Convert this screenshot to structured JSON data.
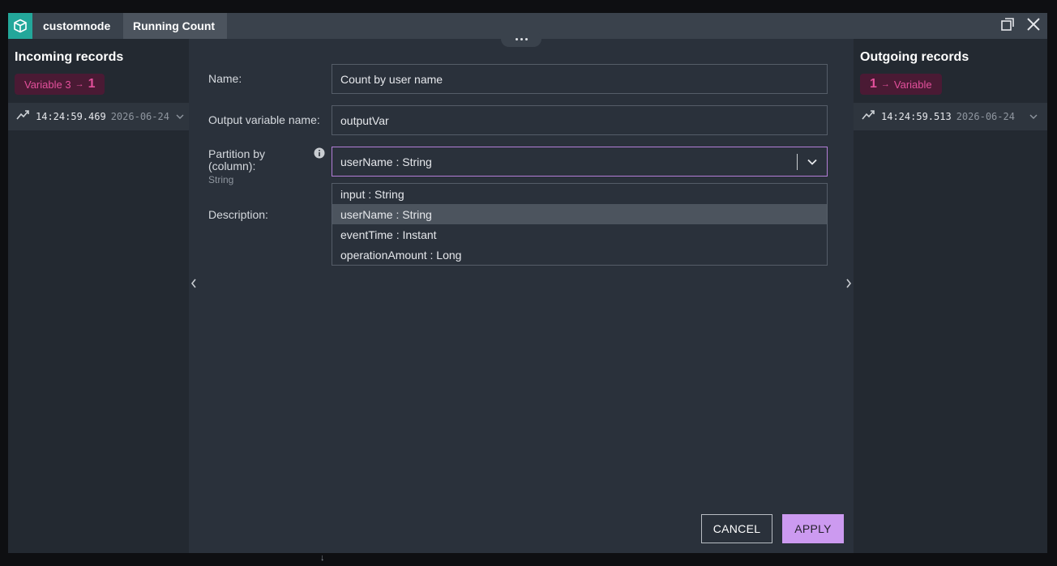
{
  "header": {
    "node_type": "customnode",
    "node_name": "Running Count",
    "icons": {
      "app": "cube-icon",
      "expand": "expand-icon",
      "close": "close-icon"
    }
  },
  "incoming": {
    "title": "Incoming records",
    "badge_text": "Variable 3",
    "badge_arrow": "→",
    "badge_count": "1",
    "record_time": "14:24:59.469",
    "record_date": "2026-06-24"
  },
  "outgoing": {
    "title": "Outgoing records",
    "badge_count": "1",
    "badge_arrow": "→",
    "badge_text": "Variable",
    "record_time": "14:24:59.513",
    "record_date": "2026-06-24"
  },
  "form": {
    "name_label": "Name:",
    "name_value": "Count by user name",
    "output_label": "Output variable name:",
    "output_value": "outputVar",
    "partition_label_1": "Partition by",
    "partition_label_2": "(column):",
    "partition_type": "String",
    "partition_selected": "userName : String",
    "partition_options": [
      {
        "label": "input : String"
      },
      {
        "label": "userName : String"
      },
      {
        "label": "eventTime : Instant"
      },
      {
        "label": "operationAmount : Long"
      }
    ],
    "description_label": "Description:"
  },
  "buttons": {
    "cancel": "CANCEL",
    "apply": "APPLY"
  },
  "colors": {
    "accent": "#cc9af0",
    "badge_text": "#e2509b",
    "badge_bg": "#4a1a34",
    "app_icon_bg": "#23a79a"
  }
}
